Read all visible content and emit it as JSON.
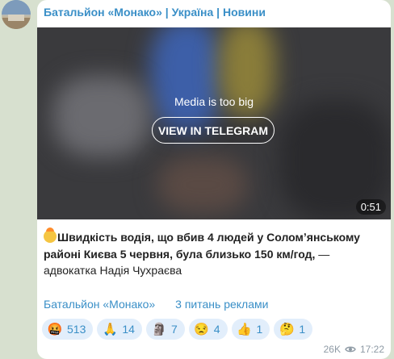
{
  "channel": {
    "title": "Батальйон «Монако» | Україна | Новини"
  },
  "media": {
    "notice": "Media is too big",
    "button_label": "VIEW IN TELEGRAM",
    "duration": "0:51"
  },
  "post": {
    "bold_text": "Швидкість водія, що вбив 4 людей у Соломʼянському районі Києва 5 червня, була близько 150 км/год,",
    "plain_text": " — адвокатка Надія Чухраєва"
  },
  "links": {
    "channel_link": "Батальйон «Монако»",
    "ads_link": "3 питань реклами"
  },
  "reactions": [
    {
      "emoji": "🤬",
      "count": "513"
    },
    {
      "emoji": "🙏",
      "count": "14"
    },
    {
      "emoji": "🗿",
      "count": "7"
    },
    {
      "emoji": "😒",
      "count": "4"
    },
    {
      "emoji": "👍",
      "count": "1"
    },
    {
      "emoji": "🤔",
      "count": "1"
    }
  ],
  "meta": {
    "views": "26K",
    "time": "17:22"
  },
  "colors": {
    "accent": "#3a8fc7",
    "reaction_bg": "#e2eefb"
  }
}
